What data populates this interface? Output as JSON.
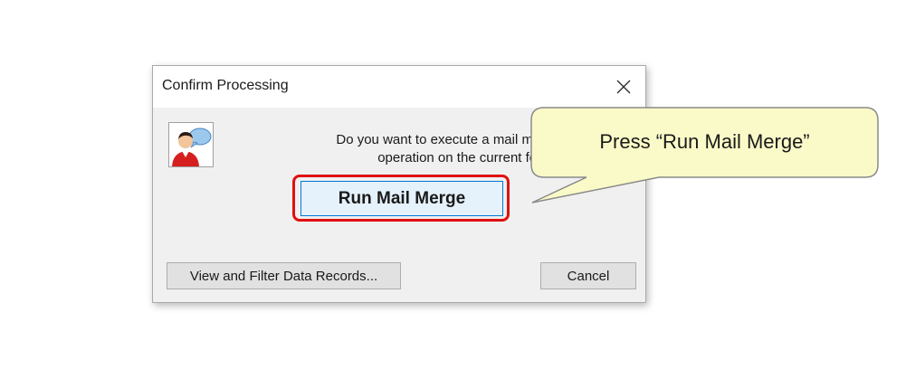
{
  "dialog": {
    "title": "Confirm Processing",
    "prompt_line1": "Do you want to execute a mail merge",
    "prompt_line2": "operation on the current form?",
    "primary_button_label": "Run Mail Merge",
    "view_button_label": "View and Filter Data Records...",
    "cancel_button_label": "Cancel",
    "icon": "user-chat-icon"
  },
  "callout": {
    "text": "Press “Run Mail Merge”",
    "fill_color": "#fafac8",
    "border_color": "#8a8a8a"
  },
  "colors": {
    "highlight": "#e01010",
    "primary_button_border": "#0078d7",
    "primary_button_fill": "#e5f1fb",
    "dialog_bg": "#f0f0f0"
  }
}
